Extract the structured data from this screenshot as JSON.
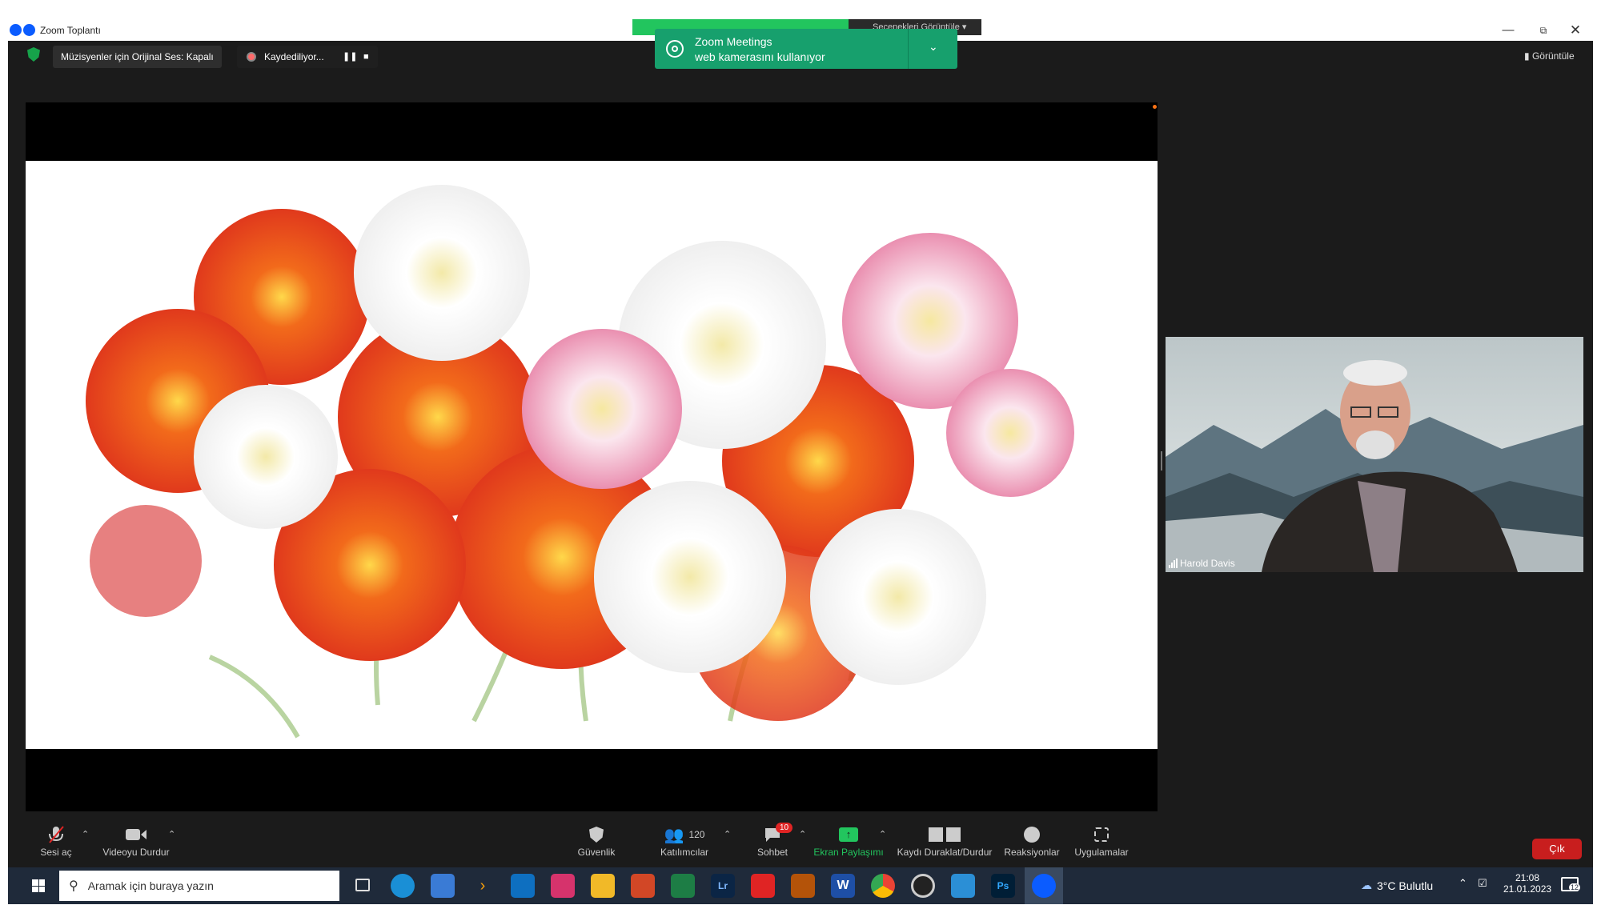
{
  "window": {
    "title": "Zoom Toplantı"
  },
  "topbar": {
    "audio_pill": "Müzisyenler için Orijinal Ses: Kapalı",
    "recording": "Kaydediliyor...",
    "view_label": "Görüntüle",
    "speaker_tab": "Harold Davis",
    "speaker_view": "Seçenekleri Görüntüle"
  },
  "toast": {
    "title": "Zoom Meetings",
    "subtitle": "web kamerasını kullanıyor"
  },
  "participant": {
    "name": "Harold Davis"
  },
  "toolbar": {
    "mute": "Sesi aç",
    "video": "Videoyu Durdur",
    "security": "Güvenlik",
    "participants": "Katılımcılar",
    "participants_count": "120",
    "chat": "Sohbet",
    "chat_badge": "10",
    "share": "Ekran Paylaşımı",
    "record": "Kaydı Duraklat/Durdur",
    "reactions": "Reaksiyonlar",
    "apps": "Uygulamalar",
    "leave": "Çık"
  },
  "taskbar": {
    "search_placeholder": "Aramak için buraya yazın",
    "weather": "3°C  Bulutlu",
    "time": "21:08",
    "date": "21.01.2023",
    "notif_count": "12",
    "apps": [
      "edge-icon",
      "store-icon",
      "chevron-icon",
      "mail-icon",
      "instagram-icon",
      "explorer-icon",
      "powerpoint-icon",
      "excel-icon",
      "lightroom-icon",
      "yandex-icon",
      "box-icon",
      "word-icon",
      "chrome-icon",
      "obs-icon",
      "meet-icon",
      "photoshop-icon",
      "zoom-icon"
    ]
  },
  "colors": {
    "accent": "#0b5cff",
    "green": "#17a06d",
    "leave": "#c81e1e",
    "share_icon": "#22c55e",
    "badge": "#e02424"
  }
}
